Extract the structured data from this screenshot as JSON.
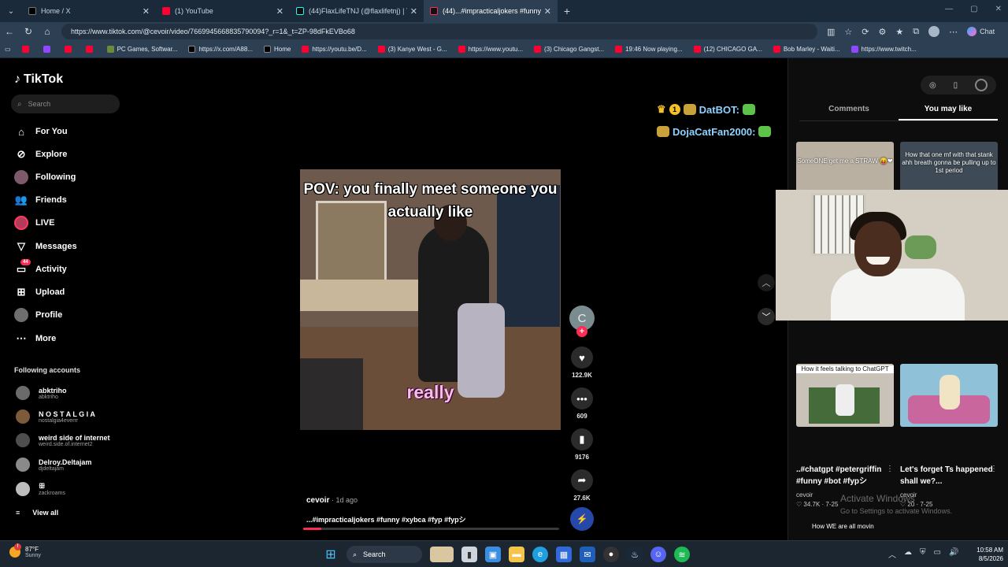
{
  "browser": {
    "tabs": [
      {
        "title": "Home / X",
        "active": false,
        "icon": "x-icon"
      },
      {
        "title": "(1) YouTube",
        "active": false,
        "icon": "youtube-icon"
      },
      {
        "title": "(44)FlaxLifeTNJ (@flaxlifetnj) | TikT",
        "active": false,
        "icon": "tiktok-icon"
      },
      {
        "title": "(44)...#impracticaljokers #funny #",
        "active": true,
        "icon": "tiktok-icon"
      }
    ],
    "url": "https://www.tiktok.com/@cevoir/video/7669945668835790094?_r=1&_t=ZP-98dFkEVBo68",
    "chat_label": "Chat",
    "bookmarks": [
      {
        "label": "",
        "icon": "youtube-icon"
      },
      {
        "label": "",
        "icon": "twitch-icon"
      },
      {
        "label": "",
        "icon": "youtube-icon"
      },
      {
        "label": "",
        "icon": "youtube-icon"
      },
      {
        "label": "PC Games, Softwar...",
        "icon": "game-icon"
      },
      {
        "label": "https://x.com/A88...",
        "icon": "x-icon"
      },
      {
        "label": "Home",
        "icon": "x-icon"
      },
      {
        "label": "https://youtu.be/D...",
        "icon": "youtube-icon"
      },
      {
        "label": "(3) Kanye West - G...",
        "icon": "youtube-icon"
      },
      {
        "label": "https://www.youtu...",
        "icon": "youtube-icon"
      },
      {
        "label": "(3) Chicago Gangst...",
        "icon": "youtube-icon"
      },
      {
        "label": "19:46 Now playing...",
        "icon": "youtube-icon"
      },
      {
        "label": "(12) CHICAGO GA...",
        "icon": "youtube-icon"
      },
      {
        "label": "Bob Marley - Waiti...",
        "icon": "youtube-icon"
      },
      {
        "label": "https://www.twitch...",
        "icon": "twitch-icon"
      }
    ]
  },
  "sidebar": {
    "logo": "TikTok",
    "search_placeholder": "Search",
    "nav": [
      {
        "label": "For You",
        "icon": "home-icon"
      },
      {
        "label": "Explore",
        "icon": "compass-icon"
      },
      {
        "label": "Following",
        "icon": "following-icon"
      },
      {
        "label": "Friends",
        "icon": "friends-icon"
      },
      {
        "label": "LIVE",
        "icon": "live-icon"
      },
      {
        "label": "Messages",
        "icon": "messages-icon"
      },
      {
        "label": "Activity",
        "icon": "activity-icon",
        "badge": "44"
      },
      {
        "label": "Upload",
        "icon": "upload-icon"
      },
      {
        "label": "Profile",
        "icon": "profile-icon"
      },
      {
        "label": "More",
        "icon": "more-icon"
      }
    ],
    "following_title": "Following accounts",
    "accounts": [
      {
        "name": "abktriho",
        "handle": "abktriho"
      },
      {
        "name": "N O S T A L G I A",
        "handle": "nostalgia4everrr"
      },
      {
        "name": "weird side of internet",
        "handle": "weird.side.of.internet2"
      },
      {
        "name": "Delroy.Deltajam",
        "handle": "djdeltajam"
      },
      {
        "name": "ꕥ",
        "handle": "zackroams"
      }
    ],
    "view_all": "View all"
  },
  "video": {
    "caption_top": "POV: you finally meet someone you actually like",
    "caption_sub": "really",
    "author": "cevoir",
    "date": " · 1d ago",
    "description": "...#impracticaljokers #funny #xybca #fyp #fypシ",
    "progress": 0.07,
    "creator_initial": "C",
    "likes": "122.9K",
    "comments": "609",
    "saves": "9176",
    "shares": "27.6K"
  },
  "chat_overlay": [
    {
      "name": "DatBOT:",
      "badge": "1"
    },
    {
      "name": "DojaCatFan2000:"
    }
  ],
  "right_panel": {
    "tabs": [
      "Comments",
      "You may like"
    ],
    "active_tab": "You may like",
    "recs": [
      {
        "thumb_caption": "SomeONE get me a STRAW 😝❤",
        "title": "",
        "author": "",
        "stats": ""
      },
      {
        "thumb_caption": "How that one mf with that stank ahh breath gonna be pulling up to 1st period",
        "title": "",
        "author": "",
        "stats": ""
      },
      {
        "thumb_caption": "How it feels talking to ChatGPT",
        "title": "..#chatgpt #petergriffin #funny #bot #fypシ",
        "author": "cevoir",
        "stats": "♡ 34.7K · 7-25"
      },
      {
        "thumb_caption": "",
        "title": "Let's forget Ts happened shall we?...",
        "author": "cevoir",
        "stats": "♡ 20 · 7-25"
      }
    ],
    "next_caption": "How WE are all movin",
    "activate_title": "Activate Windows",
    "activate_sub": "Go to Settings to activate Windows."
  },
  "taskbar": {
    "temp": "87°F",
    "weather": "Sunny",
    "search_label": "Search",
    "time": "10:58 AM",
    "date": "8/5/2026"
  },
  "colors": {
    "accent": "#fe2c55",
    "chrome_bg": "#2d3f52",
    "tab_bg": "#1b2a3b",
    "chat_name": "#8fd2ff"
  }
}
